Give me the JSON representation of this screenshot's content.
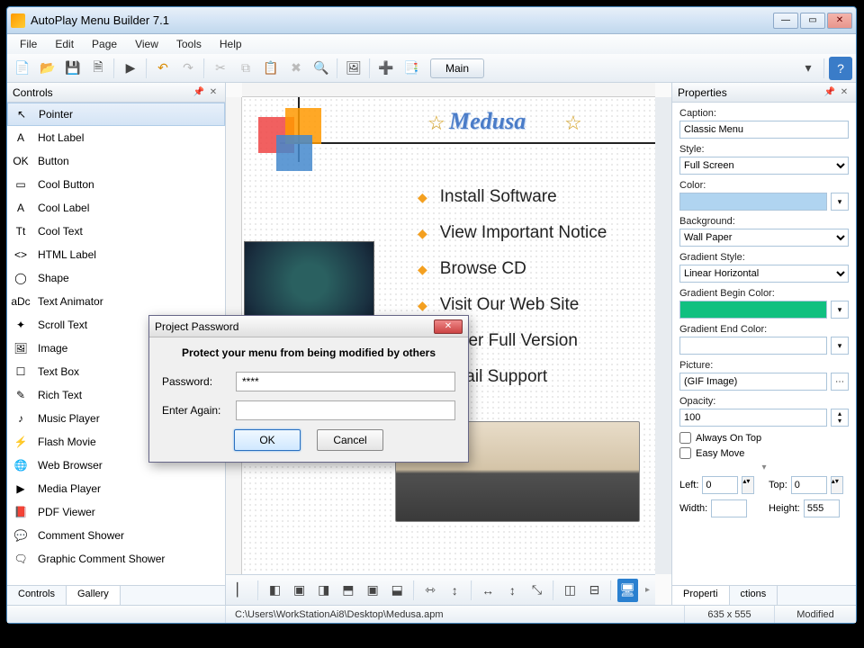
{
  "titlebar": {
    "title": "AutoPlay Menu Builder 7.1"
  },
  "menubar": [
    "File",
    "Edit",
    "Page",
    "View",
    "Tools",
    "Help"
  ],
  "toolbar_main_tab": "Main",
  "panels": {
    "controls": {
      "title": "Controls",
      "tabs": [
        "Controls",
        "Gallery"
      ],
      "active_tab": "Gallery"
    }
  },
  "controls": [
    {
      "name": "Pointer",
      "key": "pointer",
      "selected": true
    },
    {
      "name": "Hot Label",
      "key": "hot-label"
    },
    {
      "name": "Button",
      "key": "button"
    },
    {
      "name": "Cool Button",
      "key": "cool-button"
    },
    {
      "name": "Cool Label",
      "key": "cool-label"
    },
    {
      "name": "Cool Text",
      "key": "cool-text"
    },
    {
      "name": "HTML Label",
      "key": "html-label"
    },
    {
      "name": "Shape",
      "key": "shape"
    },
    {
      "name": "Text Animator",
      "key": "text-animator"
    },
    {
      "name": "Scroll Text",
      "key": "scroll-text"
    },
    {
      "name": "Image",
      "key": "image"
    },
    {
      "name": "Text Box",
      "key": "text-box"
    },
    {
      "name": "Rich Text",
      "key": "rich-text"
    },
    {
      "name": "Music Player",
      "key": "music-player"
    },
    {
      "name": "Flash Movie",
      "key": "flash-movie"
    },
    {
      "name": "Web Browser",
      "key": "web-browser"
    },
    {
      "name": "Media Player",
      "key": "media-player"
    },
    {
      "name": "PDF Viewer",
      "key": "pdf-viewer"
    },
    {
      "name": "Comment Shower",
      "key": "comment-shower"
    },
    {
      "name": "Graphic Comment Shower",
      "key": "graphic-comment-shower"
    }
  ],
  "canvas": {
    "title": "Medusa",
    "menu_items": [
      "Install Software",
      "View Important Notice",
      "Browse CD",
      "Visit Our Web Site",
      "Order Full Version",
      "Email Support"
    ]
  },
  "properties": {
    "title": "Properties",
    "caption_label": "Caption:",
    "caption_value": "Classic Menu",
    "style_label": "Style:",
    "style_value": "Full Screen",
    "color_label": "Color:",
    "color_value": "#b0d4f0",
    "background_label": "Background:",
    "background_value": "Wall Paper",
    "gradientstyle_label": "Gradient Style:",
    "gradientstyle_value": "Linear Horizontal",
    "gradbegin_label": "Gradient Begin Color:",
    "gradbegin_value": "#10c080",
    "gradend_label": "Gradient End Color:",
    "gradend_value": "#ffffff",
    "picture_label": "Picture:",
    "picture_value": "(GIF Image)",
    "opacity_label": "Opacity:",
    "opacity_value": "100",
    "alwaysontop_label": "Always On Top",
    "easymove_label": "Easy Move",
    "left_label": "Left:",
    "left_value": "0",
    "top_label": "Top:",
    "top_value": "0",
    "width_label": "Width:",
    "width_value": "",
    "height_label": "Height:",
    "height_value": "555",
    "tabs_left": "Properti",
    "tabs_right": "ctions"
  },
  "statusbar": {
    "path": "C:\\Users\\WorkStationAi8\\Desktop\\Medusa.apm",
    "dims": "635 x 555",
    "modified": "Modified"
  },
  "dialog": {
    "title": "Project Password",
    "heading": "Protect your menu from being modified by others",
    "password_label": "Password:",
    "password_value": "****",
    "enteragain_label": "Enter Again:",
    "enteragain_value": "",
    "ok": "OK",
    "cancel": "Cancel"
  }
}
